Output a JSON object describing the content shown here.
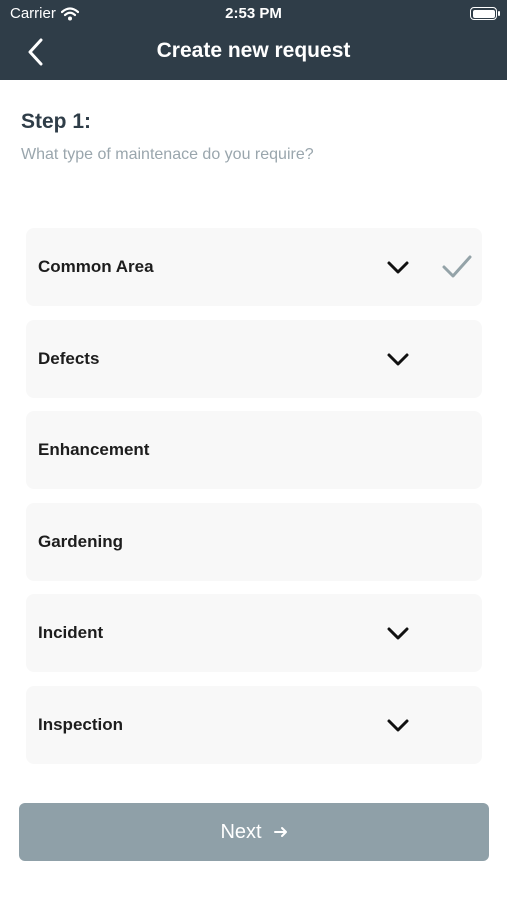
{
  "status_bar": {
    "carrier": "Carrier",
    "time": "2:53 PM"
  },
  "header": {
    "title": "Create new request",
    "back_icon": "chevron-left-icon"
  },
  "step": {
    "title": "Step 1:",
    "question": "What type of maintenace do you require?"
  },
  "options": [
    {
      "label": "Common Area",
      "expandable": true,
      "selected": true
    },
    {
      "label": "Defects",
      "expandable": true,
      "selected": false
    },
    {
      "label": "Enhancement",
      "expandable": false,
      "selected": false
    },
    {
      "label": "Gardening",
      "expandable": false,
      "selected": false
    },
    {
      "label": "Incident",
      "expandable": true,
      "selected": false
    },
    {
      "label": "Inspection",
      "expandable": true,
      "selected": false
    }
  ],
  "next_button": {
    "label": "Next",
    "icon": "arrow-right-icon"
  },
  "colors": {
    "header_bg": "#2f3d48",
    "button_bg": "#8fa0a8",
    "check": "#94a3a8",
    "card_bg": "#f8f8f8"
  }
}
